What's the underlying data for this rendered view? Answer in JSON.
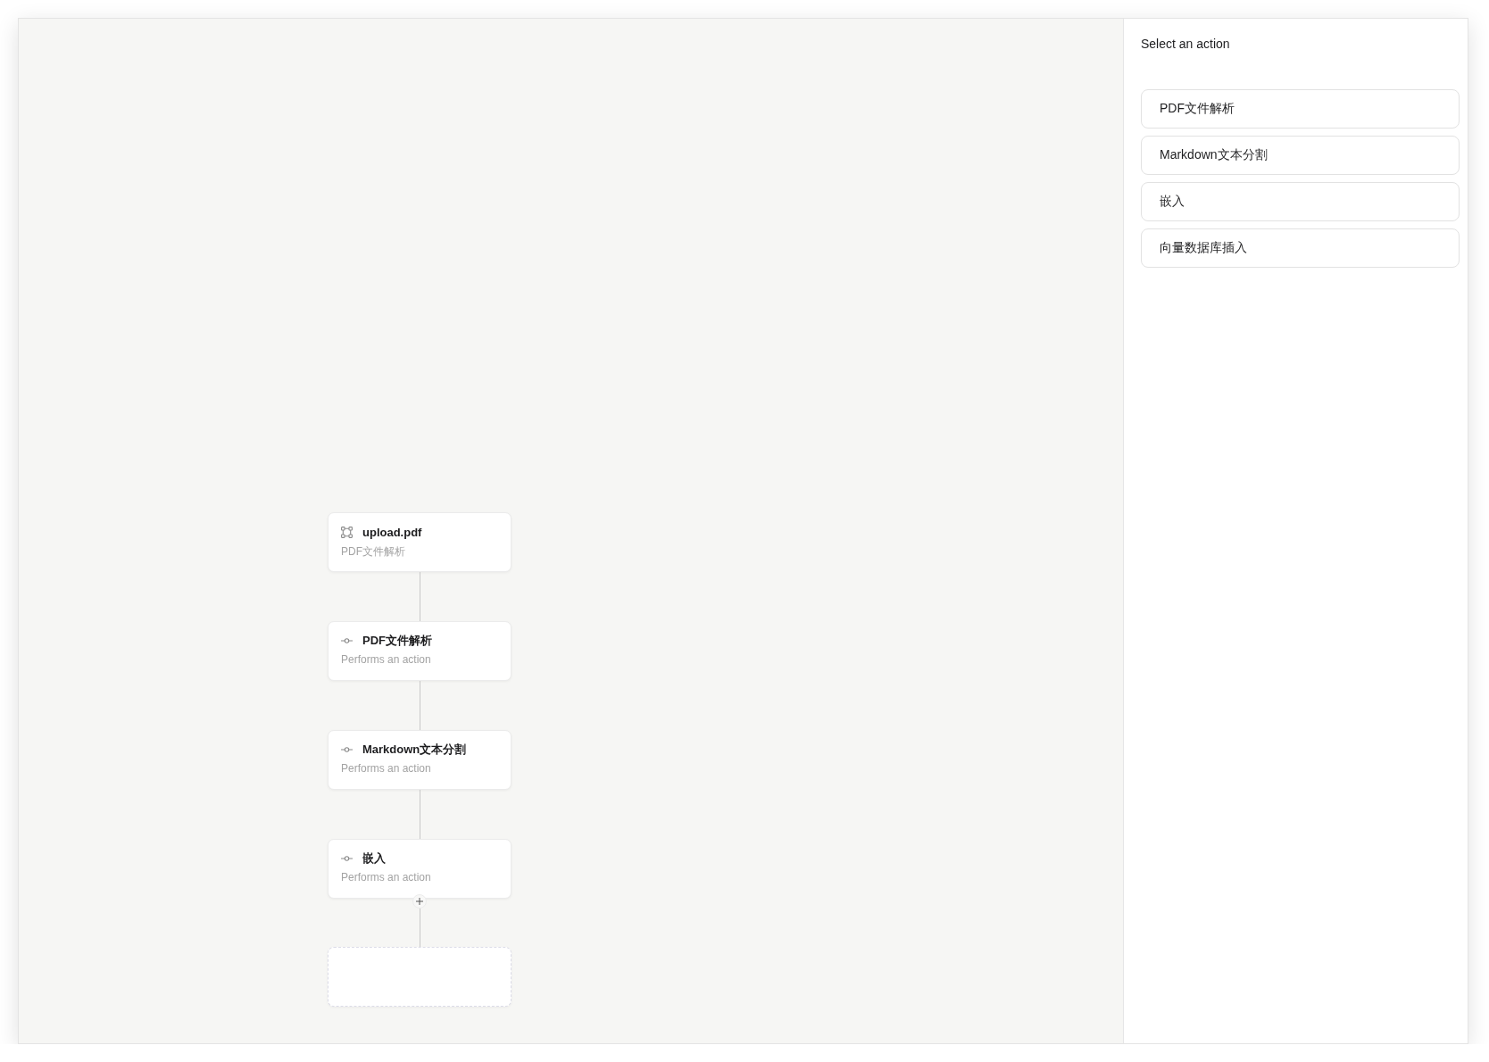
{
  "canvas": {
    "nodes": [
      {
        "kind": "trigger",
        "title": "upload.pdf",
        "subtitle": "PDF文件解析",
        "add_button": false
      },
      {
        "kind": "action",
        "title": "PDF文件解析",
        "subtitle": "Performs an action",
        "add_button": false
      },
      {
        "kind": "action",
        "title": "Markdown文本分割",
        "subtitle": "Performs an action",
        "add_button": false
      },
      {
        "kind": "action",
        "title": "嵌入",
        "subtitle": "Performs an action",
        "add_button": true
      },
      {
        "kind": "placeholder",
        "add_button": false
      }
    ]
  },
  "sidebar": {
    "title": "Select an action",
    "actions": [
      {
        "label": "PDF文件解析"
      },
      {
        "label": "Markdown文本分割"
      },
      {
        "label": "嵌入"
      },
      {
        "label": "向量数据库插入"
      }
    ]
  }
}
